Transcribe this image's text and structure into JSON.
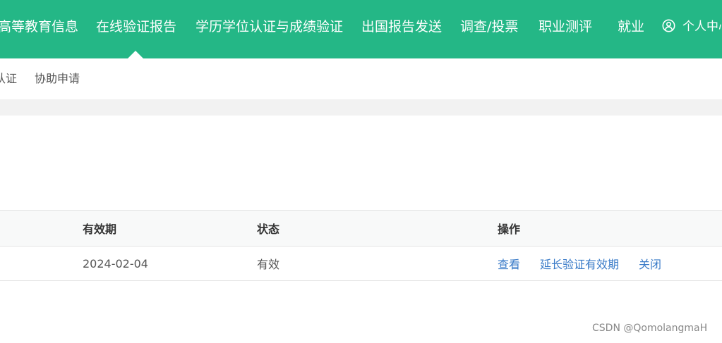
{
  "topnav": {
    "items": [
      {
        "label": "高等教育信息"
      },
      {
        "label": "在线验证报告"
      },
      {
        "label": "学历学位认证与成绩验证"
      },
      {
        "label": "出国报告发送"
      },
      {
        "label": "调查/投票"
      },
      {
        "label": "职业测评"
      },
      {
        "label": "就业"
      }
    ],
    "active_index": 1,
    "user_center_label": "个人中心",
    "user_icon": "user-circle-icon"
  },
  "subnav": {
    "items": [
      {
        "label": "认证"
      },
      {
        "label": "协助申请"
      }
    ]
  },
  "table": {
    "headers": {
      "validity": "有效期",
      "status": "状态",
      "actions": "操作"
    },
    "rows": [
      {
        "validity": "2024-02-04",
        "status": "有效",
        "actions": {
          "view": "查看",
          "extend": "延长验证有效期",
          "close": "关闭"
        }
      }
    ]
  },
  "watermark": "CSDN @QomolangmaH",
  "colors": {
    "brand": "#24b786",
    "link": "#3a7bc8"
  }
}
